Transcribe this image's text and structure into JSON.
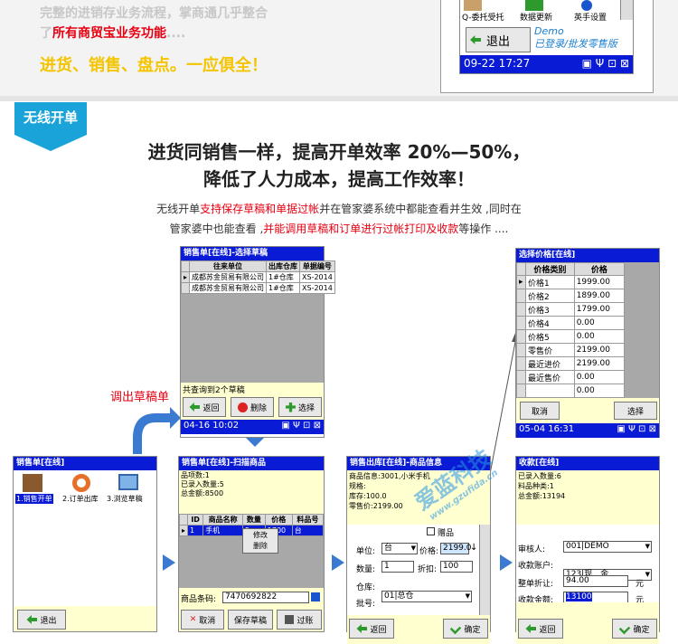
{
  "top": {
    "line1": "完整的进销存业务流程，掌商通几乎整合",
    "line2_prefix": "了",
    "line2_highlight": "所有商贸宝业务功能",
    "line2_suffix": "....",
    "line3": "进货、销售、盘点。一应俱全！",
    "pda": {
      "icons": [
        "Q-委托受托",
        "数据更新",
        "英手设置"
      ],
      "back_label": "退出",
      "demo_line1": "Demo",
      "demo_line2": "已登录/批发零售版",
      "time": "09-22 17:27"
    }
  },
  "section": {
    "tag": "无线开单",
    "headline1": "进货同销售一样，提高开单效率 20%—50%，",
    "headline2": "降低了人力成本，提高工作效率！",
    "para_l1_a": "无线开单",
    "para_l1_b": "支持保存草稿和单据过帐",
    "para_l1_c": "并在管家婆系统中都能查看并生效 ,同时在",
    "para_l2_a": "管家婆中也能查看 ,",
    "para_l2_b": "并能调用草稿和订单进行过帐打印及收款",
    "para_l2_c": "等操作 ...."
  },
  "callout": "调出草稿单",
  "draft_screen": {
    "title": "销售单[在线]-选择草稿",
    "columns": [
      "往来单位",
      "出库仓库",
      "单据编号"
    ],
    "rows": [
      [
        "成都苏金贸易有限公司",
        "1#仓库",
        "XS-2014"
      ],
      [
        "成都苏金贸易有限公司",
        "1#仓库",
        "XS-2014"
      ]
    ],
    "footer": "共查询到2个草稿",
    "buttons": [
      "返回",
      "删除",
      "选择"
    ],
    "time": "04-16 10:02"
  },
  "price_screen": {
    "title": "选择价格[在线]",
    "columns": [
      "价格类别",
      "价格"
    ],
    "rows": [
      [
        "价格1",
        "1999.00"
      ],
      [
        "价格2",
        "1899.00"
      ],
      [
        "价格3",
        "1799.00"
      ],
      [
        "价格4",
        "0.00"
      ],
      [
        "价格5",
        "0.00"
      ],
      [
        "零售价",
        "2199.00"
      ],
      [
        "最近进价",
        "2199.00"
      ],
      [
        "最近售价",
        "0.00"
      ],
      [
        "",
        "0.00"
      ]
    ],
    "buttons": [
      "取消",
      "选择"
    ],
    "time": "05-04 16:31"
  },
  "menu_screen": {
    "title": "销售单[在线]",
    "items": [
      "1.销售开单",
      "2.订单出库",
      "3.浏览草稿"
    ],
    "back": "退出"
  },
  "scan_screen": {
    "title": "销售单[在线]-扫描商品",
    "info": [
      "品项数:1",
      "已录入数量:5",
      "总金额:8500"
    ],
    "columns": [
      "ID",
      "商品名称",
      "数量",
      "价格",
      "料品号"
    ],
    "row": [
      "1",
      "手机",
      "5",
      "1700",
      "台"
    ],
    "context_menu": [
      "修改",
      "删除"
    ],
    "barcode_label": "商品条码:",
    "barcode_value": "7470692822",
    "buttons": [
      "取消",
      "保存草稿",
      "过账"
    ]
  },
  "product_screen": {
    "title": "销售出库[在线]-商品信息",
    "info": [
      "商品信息:3001,小米手机",
      "规格:",
      "库存:100.0",
      "零售价:2199.00"
    ],
    "gift_label": "赠品",
    "unit_label": "单位:",
    "unit_value": "台",
    "price_label": "价格:",
    "price_value": "2199.0",
    "qty_label": "数量:",
    "qty_value": "1",
    "discount_label": "折扣:",
    "discount_value": "100",
    "warehouse_label": "仓库:",
    "warehouse_value": "01|总仓",
    "batch_label": "批号:",
    "buttons": [
      "返回",
      "确定"
    ]
  },
  "payment_screen": {
    "title": "收款[在线]",
    "info": [
      "已录入数量:6",
      "料品种类:1",
      "总金额:13194"
    ],
    "auditor_label": "审核人:",
    "auditor_value": "001|DEMO",
    "account_label": "收款账户:",
    "account_value": "123|现　金",
    "discount_label": "整单折让:",
    "discount_value": "94.00",
    "discount_unit": "元",
    "amount_label": "收款金额:",
    "amount_value": "13100",
    "amount_unit": "元",
    "buttons": [
      "返回",
      "确定"
    ]
  },
  "watermark": {
    "line1": "爱蓝科技",
    "line2": "www.gzufida.cn"
  },
  "colors": {
    "accent_blue": "#0a1bd6",
    "tag_blue": "#1aa3d8",
    "highlight_red": "#e60012",
    "yellow": "#f5c400"
  }
}
